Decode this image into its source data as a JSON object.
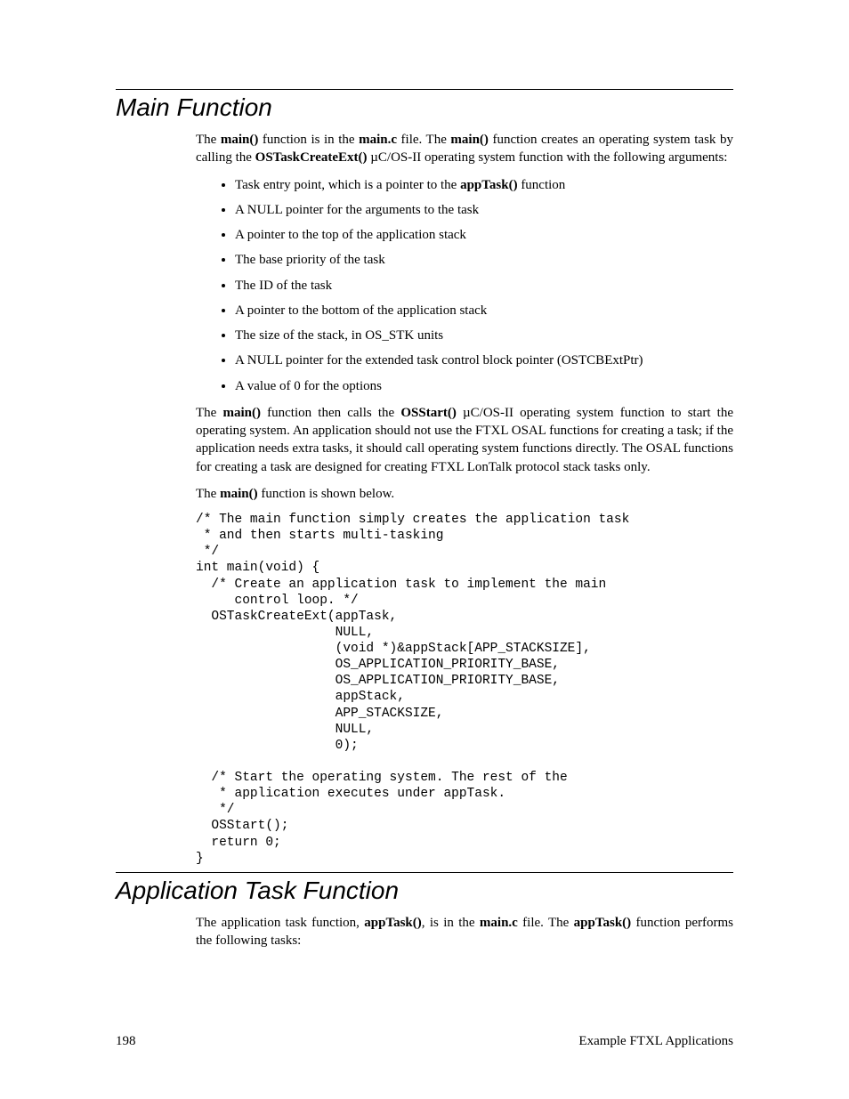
{
  "section1": {
    "heading": "Main Function",
    "para1_parts": [
      "The ",
      "main()",
      " function is in the ",
      "main.c",
      " file.  The ",
      "main()",
      " function creates an operating system task by calling the ",
      "OSTaskCreateExt()",
      " µC/OS-II operating system function with the following arguments:"
    ],
    "bullets": [
      {
        "pre": "Task entry point, which is a pointer to the ",
        "bold": "appTask()",
        "post": " function"
      },
      {
        "text": "A NULL pointer for the arguments to the task"
      },
      {
        "text": "A pointer to the top of the application stack"
      },
      {
        "text": "The base priority of the task"
      },
      {
        "text": "The ID of the task"
      },
      {
        "text": "A pointer to the bottom of the application stack"
      },
      {
        "text": "The size of the stack, in OS_STK units"
      },
      {
        "text": "A NULL pointer for the extended task control block pointer (OSTCBExtPtr)"
      },
      {
        "text": "A value of 0 for the options"
      }
    ],
    "para2_parts": [
      "The ",
      "main()",
      " function then calls the ",
      "OSStart()",
      " µC/OS-II operating system function to start the operating system.  An application should not use the FTXL OSAL functions for creating a task; if the application needs extra tasks, it should call operating system functions directly.  The OSAL functions for creating a task are designed for creating FTXL LonTalk protocol stack tasks only."
    ],
    "para3_parts": [
      "The ",
      "main()",
      " function is shown below."
    ],
    "code": "/* The main function simply creates the application task\n * and then starts multi-tasking\n */\nint main(void) {\n  /* Create an application task to implement the main\n     control loop. */\n  OSTaskCreateExt(appTask,\n                  NULL,\n                  (void *)&appStack[APP_STACKSIZE],\n                  OS_APPLICATION_PRIORITY_BASE,\n                  OS_APPLICATION_PRIORITY_BASE,\n                  appStack,\n                  APP_STACKSIZE,\n                  NULL,\n                  0);\n\n  /* Start the operating system. The rest of the\n   * application executes under appTask.\n   */\n  OSStart();\n  return 0;\n}"
  },
  "section2": {
    "heading": "Application Task Function",
    "para1_parts": [
      "The application task function, ",
      "appTask()",
      ", is in the ",
      "main.c",
      " file.  The ",
      "appTask()",
      " function performs the following tasks:"
    ]
  },
  "footer": {
    "page_number": "198",
    "right": "Example FTXL Applications"
  }
}
